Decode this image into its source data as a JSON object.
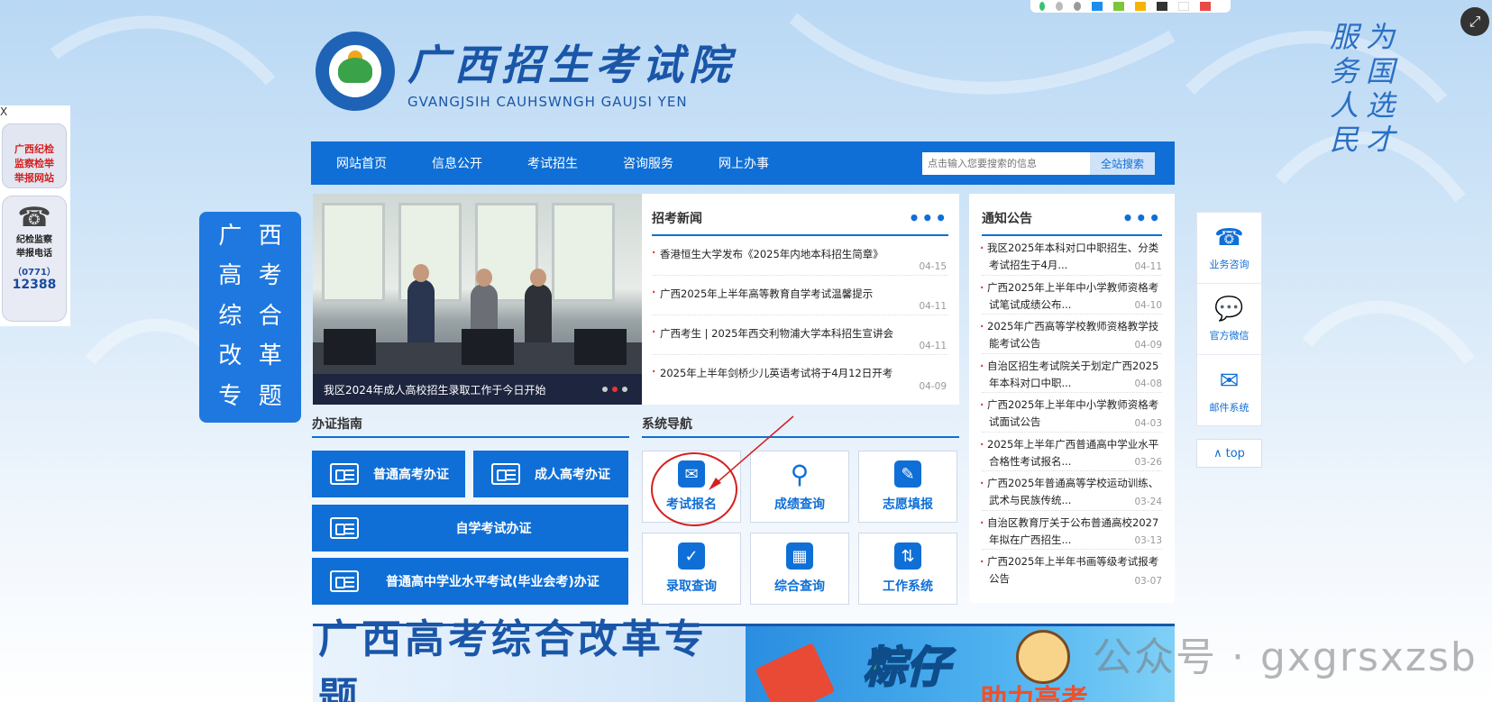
{
  "header": {
    "logo_cn": "广西招生考试院",
    "logo_en": "GVANGJSIH CAUHSWNGH GAUJSI YEN",
    "slogan_col1": [
      "为",
      "国",
      "选",
      "才"
    ],
    "slogan_col2": [
      "服",
      "务",
      "人",
      "民"
    ]
  },
  "nav": {
    "items": [
      "网站首页",
      "信息公开",
      "考试招生",
      "咨询服务",
      "网上办事"
    ],
    "search_placeholder": "点击输入您要搜索的信息",
    "search_button": "全站搜索"
  },
  "left_float": {
    "close": "X",
    "jj_lines": [
      "广西纪检",
      "监察检举",
      "举报网站"
    ],
    "tel_lines": [
      "纪检监察",
      "举报电话"
    ],
    "tel_area": "（0771）",
    "tel_num": "12388"
  },
  "reform": {
    "chars": [
      "广",
      "西",
      "高",
      "考",
      "综",
      "合",
      "改",
      "革",
      "专",
      "题"
    ]
  },
  "slider": {
    "caption": "我区2024年成人高校招生录取工作于今日开始",
    "index_label": "3"
  },
  "news": {
    "title": "招考新闻",
    "more": "•••",
    "items": [
      {
        "title": "香港恒生大学发布《2025年内地本科招生简章》",
        "date": "04-15"
      },
      {
        "title": "广西2025年上半年高等教育自学考试温馨提示",
        "date": "04-11"
      },
      {
        "title": "广西考生 | 2025年西交利物浦大学本科招生宣讲会",
        "date": "04-11"
      },
      {
        "title": "2025年上半年剑桥少儿英语考试将于4月12日开考",
        "date": "04-09"
      }
    ]
  },
  "notice": {
    "title": "通知公告",
    "more": "•••",
    "items": [
      {
        "title": "我区2025年本科对口中职招生、分类考试招生于4月...",
        "date": "04-11"
      },
      {
        "title": "广西2025年上半年中小学教师资格考试笔试成绩公布...",
        "date": "04-10"
      },
      {
        "title": "2025年广西高等学校教师资格教学技能考试公告",
        "date": "04-09"
      },
      {
        "title": "自治区招生考试院关于划定广西2025年本科对口中职...",
        "date": "04-08"
      },
      {
        "title": "广西2025年上半年中小学教师资格考试面试公告",
        "date": "04-03"
      },
      {
        "title": "2025年上半年广西普通高中学业水平合格性考试报名...",
        "date": "03-26"
      },
      {
        "title": "广西2025年普通高等学校运动训练、武术与民族传统...",
        "date": "03-24"
      },
      {
        "title": "自治区教育厅关于公布普通高校2027年拟在广西招生...",
        "date": "03-13"
      },
      {
        "title": "广西2025年上半年书画等级考试报考公告",
        "date": "03-07"
      }
    ]
  },
  "guide": {
    "title": "办证指南",
    "buttons": [
      "普通高考办证",
      "成人高考办证",
      "自学考试办证",
      "普通高中学业水平考试(毕业会考)办证"
    ]
  },
  "system": {
    "title": "系统导航",
    "tiles": [
      {
        "label": "考试报名",
        "icon": "envelope-form-icon"
      },
      {
        "label": "成绩查询",
        "icon": "magnifier-icon"
      },
      {
        "label": "志愿填报",
        "icon": "edit-form-icon"
      },
      {
        "label": "录取查询",
        "icon": "clipboard-check-icon"
      },
      {
        "label": "综合查询",
        "icon": "grid-search-icon"
      },
      {
        "label": "工作系统",
        "icon": "sliders-icon"
      }
    ]
  },
  "right_float": {
    "items": [
      {
        "label": "业务咨询",
        "icon": "phone-icon"
      },
      {
        "label": "官方微信",
        "icon": "wechat-icon"
      },
      {
        "label": "邮件系统",
        "icon": "mail-icon"
      }
    ],
    "top": "top"
  },
  "banner": {
    "left_text": "广西高考综合改革专题",
    "right_big": "粽仔",
    "right_sub": "助力高考"
  },
  "watermark": "公众号 · gxgrsxzsb",
  "colors": {
    "primary": "#0f6fd6",
    "accent_red": "#d42020"
  }
}
